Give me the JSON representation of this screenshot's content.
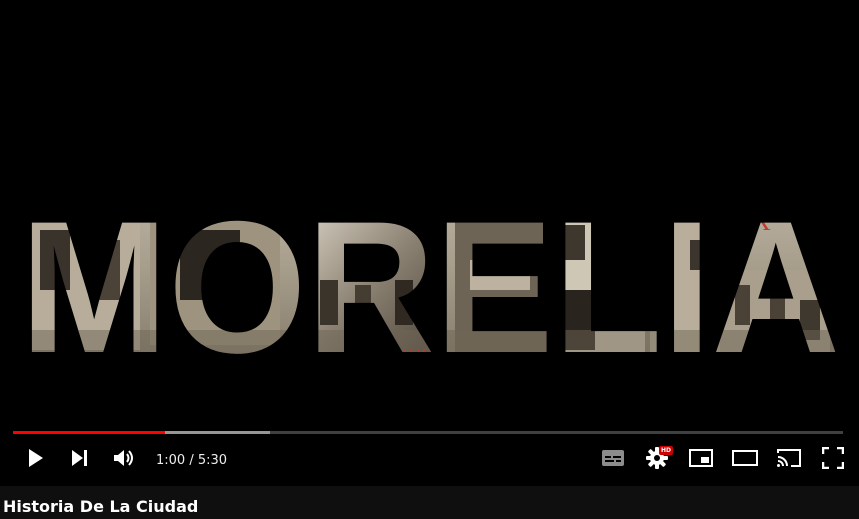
{
  "video": {
    "overlay_text": "MORELIA",
    "title": "Historia De La Ciudad"
  },
  "player": {
    "current_time": "1:00",
    "duration": "5:30",
    "time_display": "1:00 / 5:30",
    "played_fraction": 0.183,
    "buffered_fraction": 0.31,
    "quality_badge": "HD",
    "accent_color": "#ff0000"
  },
  "controls": {
    "left": [
      {
        "name": "play-button",
        "icon": "play-icon"
      },
      {
        "name": "next-button",
        "icon": "skip-next-icon"
      },
      {
        "name": "volume-button",
        "icon": "volume-icon"
      }
    ],
    "right": [
      {
        "name": "subtitles-button",
        "icon": "subtitles-icon"
      },
      {
        "name": "settings-button",
        "icon": "gear-icon"
      },
      {
        "name": "miniplayer-button",
        "icon": "miniplayer-icon"
      },
      {
        "name": "theater-button",
        "icon": "theater-mode-icon"
      },
      {
        "name": "cast-button",
        "icon": "cast-icon"
      },
      {
        "name": "fullscreen-button",
        "icon": "fullscreen-icon"
      }
    ]
  }
}
